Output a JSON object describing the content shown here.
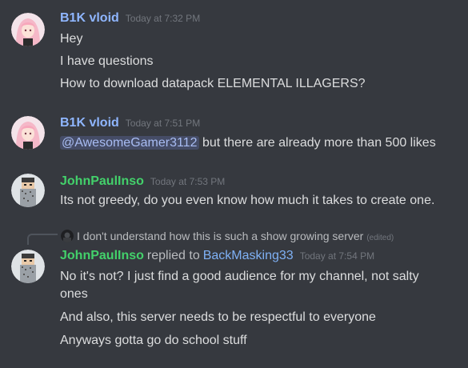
{
  "colors": {
    "background": "#36393f",
    "text": "#dcddde",
    "muted": "#72767d",
    "username_b1k": "#8fb6ff",
    "username_john": "#43d16b",
    "reply_target": "#7fb1f5",
    "mention_bg": "#3e4a78",
    "mention_text": "#a8bcf3"
  },
  "messages": [
    {
      "author": "B1K vloid",
      "timestamp": "Today at 7:32 PM",
      "avatar_icon": "anime-girl-avatar-icon",
      "lines": [
        "Hey",
        "I have questions",
        "How to download datapack ELEMENTAL  ILLAGERS?"
      ]
    },
    {
      "author": "B1K vloid",
      "timestamp": "Today at 7:51 PM",
      "avatar_icon": "anime-girl-avatar-icon",
      "mention": "@AwesomeGamer3112",
      "text_after_mention": " but there are already more than 500 likes"
    },
    {
      "author": "JohnPaulInso",
      "timestamp": "Today at 7:53 PM",
      "avatar_icon": "minecraft-skin-avatar-icon",
      "lines": [
        "Its not greedy, do you even know how much it takes to create one."
      ]
    },
    {
      "author": "JohnPaulInso",
      "reply_word": "replied to",
      "reply_to": "BackMasking33",
      "timestamp": "Today at 7:54 PM",
      "avatar_icon": "minecraft-skin-avatar-icon",
      "reply_context": {
        "text": "I don't understand how this is such a show growing server",
        "edited": "(edited)",
        "avatar_icon": "dark-mini-avatar-icon"
      },
      "lines": [
        "No it's not? I just find a good audience for my channel, not salty",
        "ones",
        "And also, this server needs to be respectful to everyone",
        "Anyways gotta go do school stuff"
      ]
    }
  ]
}
